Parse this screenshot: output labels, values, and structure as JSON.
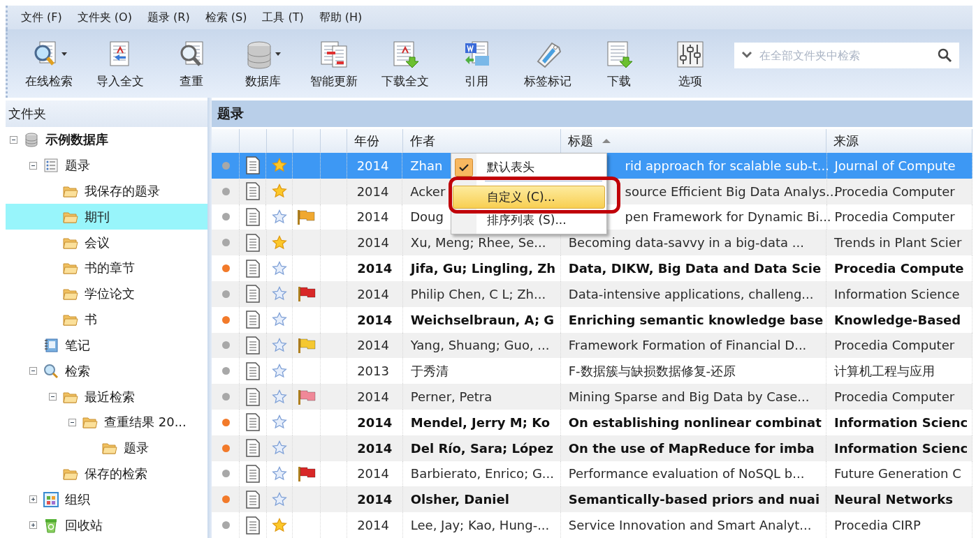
{
  "menu_bar": [
    "文件 (F)",
    "文件夹 (O)",
    "题录 (R)",
    "检索 (S)",
    "工具 (T)",
    "帮助 (H)"
  ],
  "toolbar": {
    "buttons": [
      {
        "label": "在线检索",
        "dropdown": true
      },
      {
        "label": "导入全文",
        "dropdown": false
      },
      {
        "label": "查重",
        "dropdown": false
      },
      {
        "label": "数据库",
        "dropdown": true
      },
      {
        "label": "智能更新",
        "dropdown": false
      },
      {
        "label": "下载全文",
        "dropdown": false
      },
      {
        "label": "引用",
        "dropdown": false
      },
      {
        "label": "标签标记",
        "dropdown": false
      },
      {
        "label": "下载",
        "dropdown": false
      },
      {
        "label": "选项",
        "dropdown": false
      }
    ],
    "search": {
      "placeholder": "在全部文件夹中检索"
    }
  },
  "folder_panel": {
    "title": "文件夹",
    "tree": [
      {
        "kind": "database",
        "label": "示例数据库",
        "selected": false,
        "expanded": true,
        "children": [
          {
            "kind": "list",
            "label": "题录",
            "selected": false,
            "expanded": true,
            "children": [
              {
                "kind": "folder",
                "label": "我保存的题录",
                "selected": false
              },
              {
                "kind": "folder",
                "label": "期刊",
                "selected": true
              },
              {
                "kind": "folder",
                "label": "会议",
                "selected": false
              },
              {
                "kind": "folder",
                "label": "书的章节",
                "selected": false
              },
              {
                "kind": "folder",
                "label": "学位论文",
                "selected": false
              },
              {
                "kind": "folder",
                "label": "书",
                "selected": false
              }
            ]
          },
          {
            "kind": "notebook",
            "label": "笔记",
            "selected": false
          },
          {
            "kind": "search",
            "label": "检索",
            "selected": false,
            "expanded": true,
            "children": [
              {
                "kind": "folder",
                "label": "最近检索",
                "selected": false,
                "expanded": true,
                "children": [
                  {
                    "kind": "folder",
                    "label": "查重结果 20...",
                    "selected": false,
                    "expanded": true,
                    "children": [
                      {
                        "kind": "folder",
                        "label": "题录",
                        "selected": false
                      }
                    ]
                  }
                ]
              },
              {
                "kind": "folder",
                "label": "保存的检索",
                "selected": false
              }
            ]
          },
          {
            "kind": "organize",
            "label": "组织",
            "selected": false,
            "expanded": false
          },
          {
            "kind": "recycle",
            "label": "回收站",
            "selected": false,
            "expanded": false
          }
        ]
      }
    ]
  },
  "reference_panel": {
    "title": "题录",
    "columns": [
      {
        "kind": "status"
      },
      {
        "kind": "attachment"
      },
      {
        "kind": "star"
      },
      {
        "kind": "flag"
      },
      {
        "kind": "blank"
      },
      {
        "kind": "text",
        "label": "年份"
      },
      {
        "kind": "text",
        "label": "作者"
      },
      {
        "kind": "text",
        "label": "标题",
        "sorted": true
      },
      {
        "kind": "text",
        "label": "来源"
      }
    ],
    "rows": [
      {
        "selected": true,
        "unread": false,
        "starred": true,
        "covered": true,
        "year": "2014",
        "author": "Zhan",
        "title": "rid approach for scalable sub-t...",
        "source": "Journal of Compute"
      },
      {
        "selected": false,
        "unread": false,
        "starred": true,
        "covered": true,
        "year": "2014",
        "author": "Acker",
        "title": "source Efficient Big Data Analys...",
        "source": "Procedia Computer"
      },
      {
        "selected": false,
        "unread": false,
        "starred": false,
        "covered": true,
        "flag": {
          "color": "#f0a830"
        },
        "year": "2014",
        "author": "Doug",
        "title": "pen Framework for Dynamic Bi...",
        "source": "Procedia Computer"
      },
      {
        "selected": false,
        "unread": false,
        "starred": true,
        "covered": false,
        "year": "2014",
        "author": "Xu, Meng; Rhee, Se...",
        "title": "Becoming data-savvy in a big-data ...",
        "source": "Trends in Plant Scier"
      },
      {
        "selected": false,
        "unread": true,
        "starred": false,
        "covered": false,
        "year": "2014",
        "author": "Jifa, Gu; Lingling, Zh",
        "title": "Data, DIKW, Big Data and Data Scie",
        "source": "Procedia Compute"
      },
      {
        "selected": false,
        "unread": false,
        "starred": false,
        "covered": false,
        "flag": {
          "color": "#d82828"
        },
        "year": "2014",
        "author": "Philip Chen, C L; Zh...",
        "title": "Data-intensive applications, challeng...",
        "source": "Information Science"
      },
      {
        "selected": false,
        "unread": true,
        "starred": false,
        "covered": false,
        "year": "2014",
        "author": "Weichselbraun, A; G",
        "title": "Enriching semantic knowledge base",
        "source": "Knowledge-Based"
      },
      {
        "selected": false,
        "unread": false,
        "starred": false,
        "covered": false,
        "flag": {
          "color": "#f5c832"
        },
        "year": "2014",
        "author": "Yang, Shuang; Guo, ...",
        "title": "Framework Formation of Financial D...",
        "source": "Procedia Computer"
      },
      {
        "selected": false,
        "unread": false,
        "starred": false,
        "covered": false,
        "year": "2013",
        "author": "于秀清",
        "title": "F-数据簇与缺损数据修复-还原",
        "source": "计算机工程与应用"
      },
      {
        "selected": false,
        "unread": false,
        "starred": false,
        "covered": false,
        "flag": {
          "color": "#f08898"
        },
        "year": "2014",
        "author": "Perner, Petra",
        "title": "Mining Sparse and Big Data by Case...",
        "source": "Procedia Computer"
      },
      {
        "selected": false,
        "unread": true,
        "starred": false,
        "covered": false,
        "year": "2014",
        "author": "Mendel, Jerry M; Ko",
        "title": "On establishing nonlinear combinat",
        "source": "Information Scienc"
      },
      {
        "selected": false,
        "unread": true,
        "starred": false,
        "covered": false,
        "year": "2014",
        "author": "Del Río, Sara; López",
        "title": "On the use of MapReduce for imba",
        "source": "Information Scienc"
      },
      {
        "selected": false,
        "unread": false,
        "starred": false,
        "covered": false,
        "flag": {
          "color": "#d82828"
        },
        "year": "2014",
        "author": "Barbierato, Enrico; G...",
        "title": "Performance evaluation of NoSQL b...",
        "source": "Future Generation C"
      },
      {
        "selected": false,
        "unread": true,
        "starred": false,
        "covered": false,
        "year": "2014",
        "author": "Olsher, Daniel",
        "title": "Semantically-based priors and nuai",
        "source": "Neural Networks"
      },
      {
        "selected": false,
        "unread": false,
        "starred": true,
        "covered": false,
        "year": "2014",
        "author": "Lee, Jay; Kao, Hung-...",
        "title": "Service Innovation and Smart Analyt...",
        "source": "Procedia CIRP"
      }
    ],
    "context_menu": {
      "items": [
        {
          "kind": "item",
          "label": "默认表头",
          "checked": true,
          "selected": false,
          "circled": false
        },
        {
          "kind": "separator"
        },
        {
          "kind": "item",
          "label": "自定义 (C)...",
          "checked": false,
          "selected": true,
          "circled": true
        },
        {
          "kind": "item",
          "label": "排序列表 (S)...",
          "checked": false,
          "selected": false,
          "circled": false
        }
      ]
    }
  }
}
